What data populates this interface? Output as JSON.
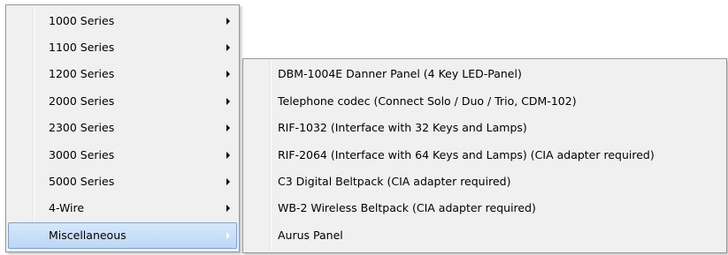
{
  "primary_menu": {
    "items": [
      {
        "label": "1000 Series",
        "submenu_arrow": "chevron-right-icon"
      },
      {
        "label": "1100 Series",
        "submenu_arrow": "chevron-right-icon"
      },
      {
        "label": "1200 Series",
        "submenu_arrow": "chevron-right-icon"
      },
      {
        "label": "2000 Series",
        "submenu_arrow": "chevron-right-icon"
      },
      {
        "label": "2300 Series",
        "submenu_arrow": "chevron-right-icon"
      },
      {
        "label": "3000 Series",
        "submenu_arrow": "chevron-right-icon"
      },
      {
        "label": "5000 Series",
        "submenu_arrow": "chevron-right-icon"
      },
      {
        "label": "4-Wire",
        "submenu_arrow": "chevron-right-icon"
      },
      {
        "label": "Miscellaneous",
        "submenu_arrow": "chevron-right-icon",
        "highlighted": true
      }
    ]
  },
  "submenu": {
    "parent": "Miscellaneous",
    "items": [
      {
        "label": "DBM-1004E Danner Panel (4 Key LED-Panel)"
      },
      {
        "label": "Telephone codec (Connect Solo / Duo / Trio, CDM-102)"
      },
      {
        "label": "RIF-1032 (Interface with 32 Keys and Lamps)"
      },
      {
        "label": "RIF-2064 (Interface with 64 Keys and Lamps) (CIA adapter required)"
      },
      {
        "label": "C3 Digital Beltpack (CIA adapter required)"
      },
      {
        "label": "WB-2 Wireless Beltpack (CIA adapter required)"
      },
      {
        "label": "Aurus Panel"
      }
    ]
  },
  "colors": {
    "menu_background": "#f0f0f0",
    "menu_border": "#979797",
    "highlight_fill": "#c4dcf7",
    "highlight_border": "#7da2ce"
  }
}
